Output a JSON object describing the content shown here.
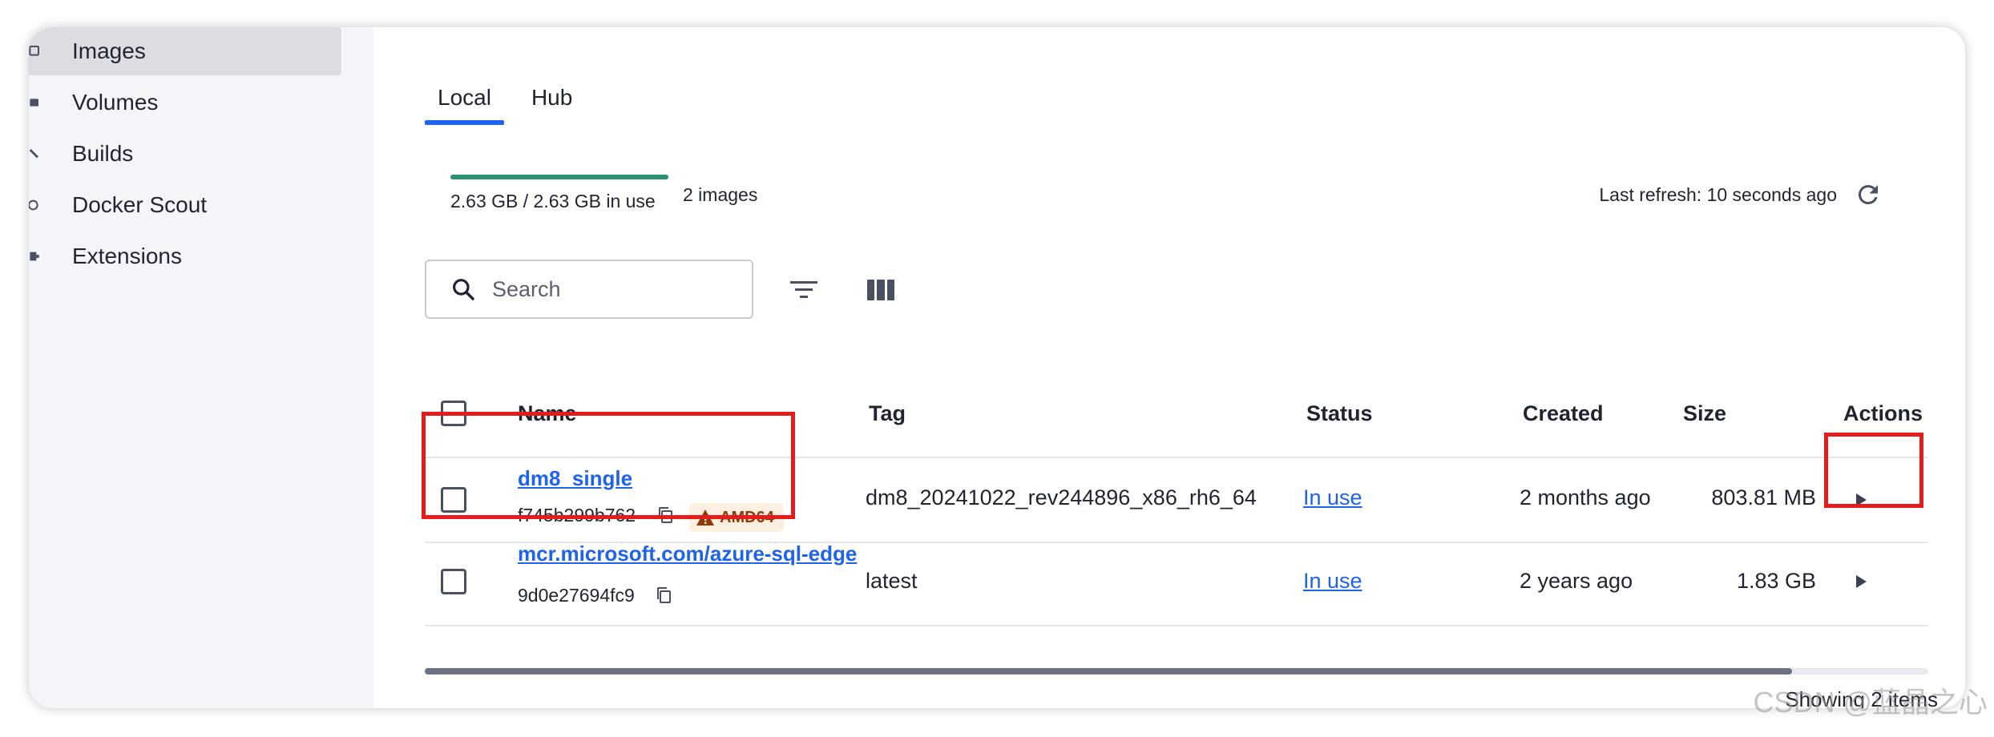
{
  "sidebar": {
    "items": [
      {
        "label": "Images",
        "icon": "images-icon",
        "active": true
      },
      {
        "label": "Volumes",
        "icon": "volumes-icon",
        "active": false
      },
      {
        "label": "Builds",
        "icon": "builds-icon",
        "active": false
      },
      {
        "label": "Docker Scout",
        "icon": "docker-scout-icon",
        "active": false
      },
      {
        "label": "Extensions",
        "icon": "extensions-icon",
        "active": false
      }
    ]
  },
  "tabs": [
    {
      "label": "Local",
      "active": true
    },
    {
      "label": "Hub",
      "active": false
    }
  ],
  "usage": {
    "text": "2.63 GB / 2.63 GB in use",
    "count": "2 images",
    "fill_fraction": 1.0,
    "color": "#2e8f77"
  },
  "refresh": {
    "text": "Last refresh: 10 seconds ago",
    "icon": "refresh-icon"
  },
  "search": {
    "placeholder": "Search",
    "value": ""
  },
  "toolbar": {
    "filter_icon": "filter-icon",
    "columns_icon": "columns-icon"
  },
  "table": {
    "headers": {
      "name": "Name",
      "tag": "Tag",
      "status": "Status",
      "created": "Created",
      "size": "Size",
      "actions": "Actions"
    },
    "rows": [
      {
        "name": "dm8_single",
        "id": "f745b299b762",
        "arch": "AMD64",
        "tag": "dm8_20241022_rev244896_x86_rh6_64",
        "status": "In use",
        "created": "2 months ago",
        "size": "803.81 MB"
      },
      {
        "name": "mcr.microsoft.com/azure-sql-edge",
        "id": "9d0e27694fc9",
        "tag": "latest",
        "status": "In use",
        "created": "2 years ago",
        "size": "1.83 GB"
      }
    ]
  },
  "footer": {
    "text": "Showing 2 items"
  },
  "watermark": "CSDN @蓝晶之心",
  "colors": {
    "accent": "#1d63ed",
    "highlight": "#e41c1c",
    "badge_bg": "#fdf0e0",
    "badge_text": "#8a3b0a"
  }
}
